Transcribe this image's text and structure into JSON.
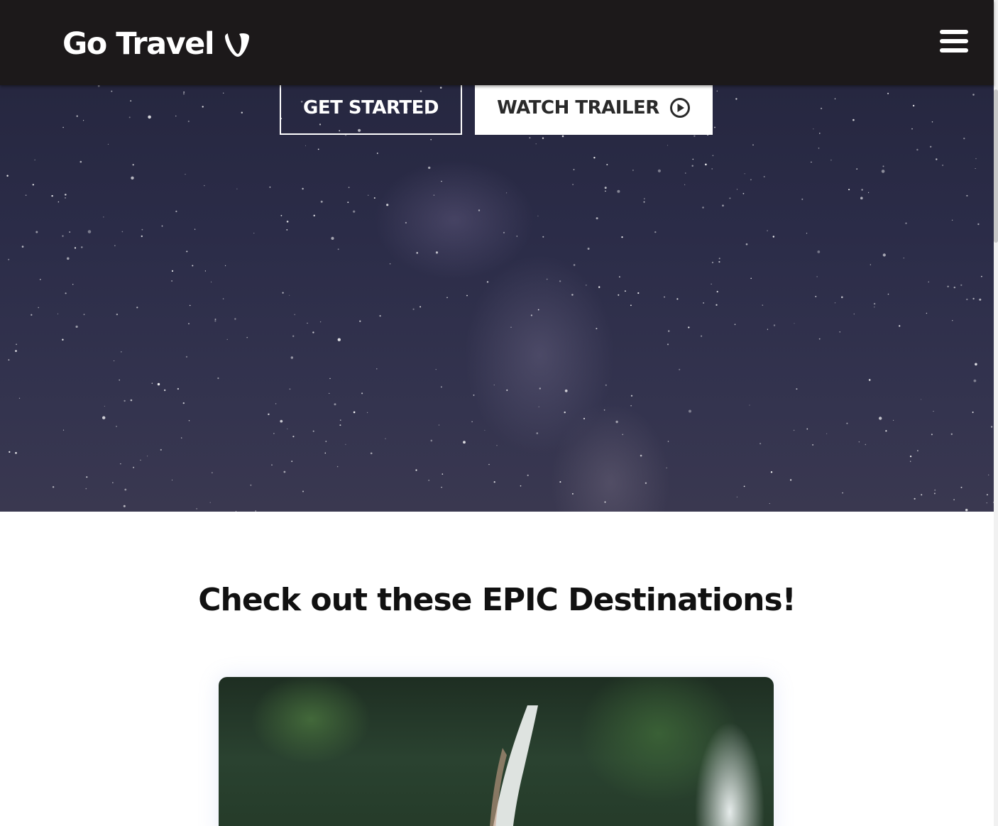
{
  "navbar": {
    "brand_text": "Go Travel",
    "brand_logo_icon": "typo3-logo-icon",
    "menu_icon": "hamburger-menu-icon",
    "background_color": "#1c191a"
  },
  "hero": {
    "get_started_label": "GET STARTED",
    "watch_trailer_label": "WATCH TRAILER",
    "watch_trailer_icon": "play-circle-icon"
  },
  "destinations": {
    "title": "Check out these EPIC Destinations!",
    "card_image_subject": "waterfall-jungle-photo"
  }
}
